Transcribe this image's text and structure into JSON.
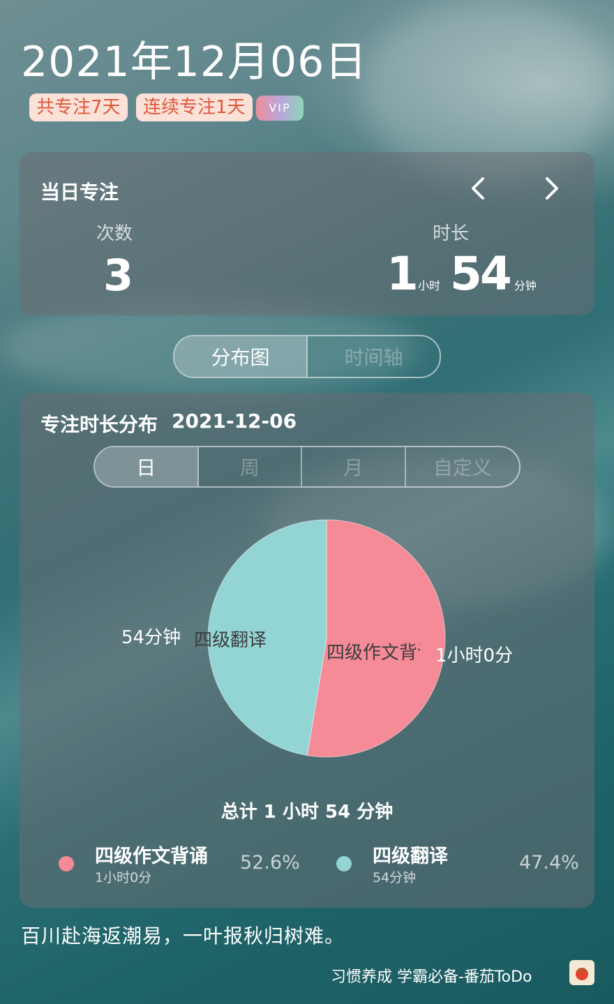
{
  "header": {
    "date": "2021年12月06日",
    "badges": [
      "共专注7天",
      "连续专注1天"
    ],
    "vip_label": "VIP"
  },
  "daily": {
    "title": "当日专注",
    "count_label": "次数",
    "count_value": "3",
    "duration_label": "时长",
    "hours": "1",
    "hours_unit": "小时",
    "minutes": "54",
    "minutes_unit": "分钟"
  },
  "view_tabs": [
    "分布图",
    "时间轴"
  ],
  "distribution": {
    "title": "专注时长分布",
    "date": "2021-12-06",
    "period_tabs": [
      "日",
      "周",
      "月",
      "自定义"
    ],
    "total": "总计 1 小时 54 分钟",
    "legend": [
      {
        "name": "四级作文背诵",
        "duration": "1小时0分",
        "percent": "52.6%",
        "color": "#f58b97"
      },
      {
        "name": "四级翻译",
        "duration": "54分钟",
        "percent": "47.4%",
        "color": "#92d5d4"
      }
    ],
    "pie_labels": {
      "a_inner": "四级作文背诵",
      "a_outer": "1小时0分",
      "b_inner": "四级翻译",
      "b_outer": "54分钟"
    }
  },
  "chart_data": {
    "type": "pie",
    "categories": [
      "四级作文背诵",
      "四级翻译"
    ],
    "values": [
      52.6,
      47.4
    ],
    "colors": [
      "#f58b97",
      "#92d5d4"
    ]
  },
  "footer": {
    "quote": "百川赴海返潮易，一叶报秋归树难。",
    "app_tagline": "习惯养成 学霸必备-番茄ToDo"
  }
}
